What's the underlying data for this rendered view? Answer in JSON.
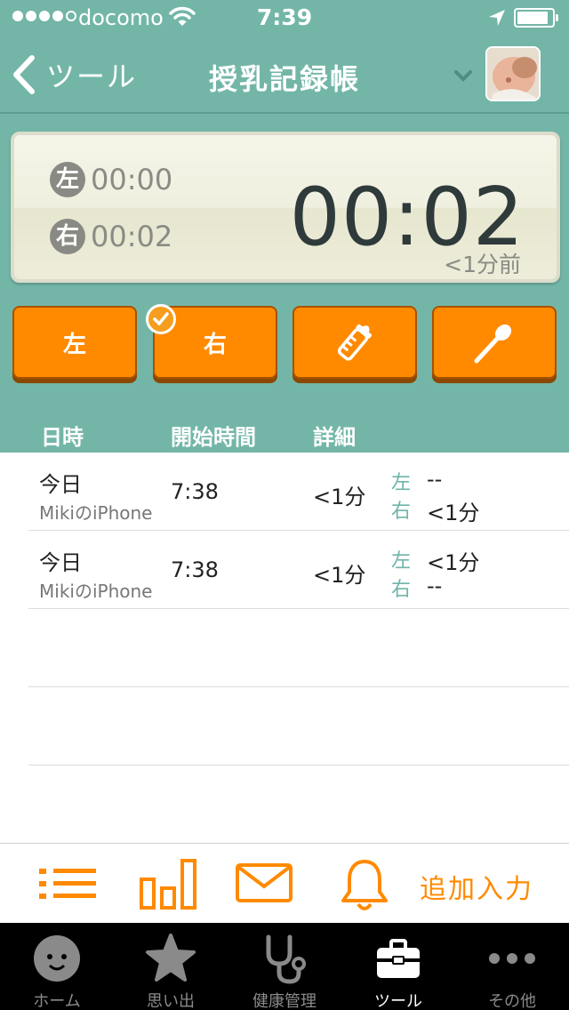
{
  "status_bar": {
    "carrier": "docomo",
    "time": "7:39"
  },
  "nav": {
    "back_label": "ツール",
    "title": "授乳記録帳"
  },
  "timer": {
    "left_badge": "左",
    "left_time": "00:00",
    "right_badge": "右",
    "right_time": "00:02",
    "elapsed": "00:02",
    "ago": "<1分前"
  },
  "actions": {
    "left_label": "左",
    "right_label": "右"
  },
  "table": {
    "headers": {
      "datetime": "日時",
      "start": "開始時間",
      "detail": "詳細"
    },
    "rows": [
      {
        "day": "今日",
        "device": "MikiのiPhone",
        "start": "7:38",
        "duration": "<1分",
        "left_label": "左",
        "left_value": "--",
        "right_label": "右",
        "right_value": "<1分"
      },
      {
        "day": "今日",
        "device": "MikiのiPhone",
        "start": "7:38",
        "duration": "<1分",
        "left_label": "左",
        "left_value": "<1分",
        "right_label": "右",
        "right_value": "--"
      }
    ]
  },
  "toolbar": {
    "add_entry": "追加入力"
  },
  "tabs": [
    {
      "label": "ホーム",
      "icon": "baby-face-icon"
    },
    {
      "label": "思い出",
      "icon": "star-icon"
    },
    {
      "label": "健康管理",
      "icon": "stethoscope-icon"
    },
    {
      "label": "ツール",
      "icon": "toolbox-icon"
    },
    {
      "label": "その他",
      "icon": "more-dots-icon"
    }
  ],
  "colors": {
    "teal": "#73b6a8",
    "orange": "#ff8a00",
    "badge_gray": "#8a8a84"
  }
}
